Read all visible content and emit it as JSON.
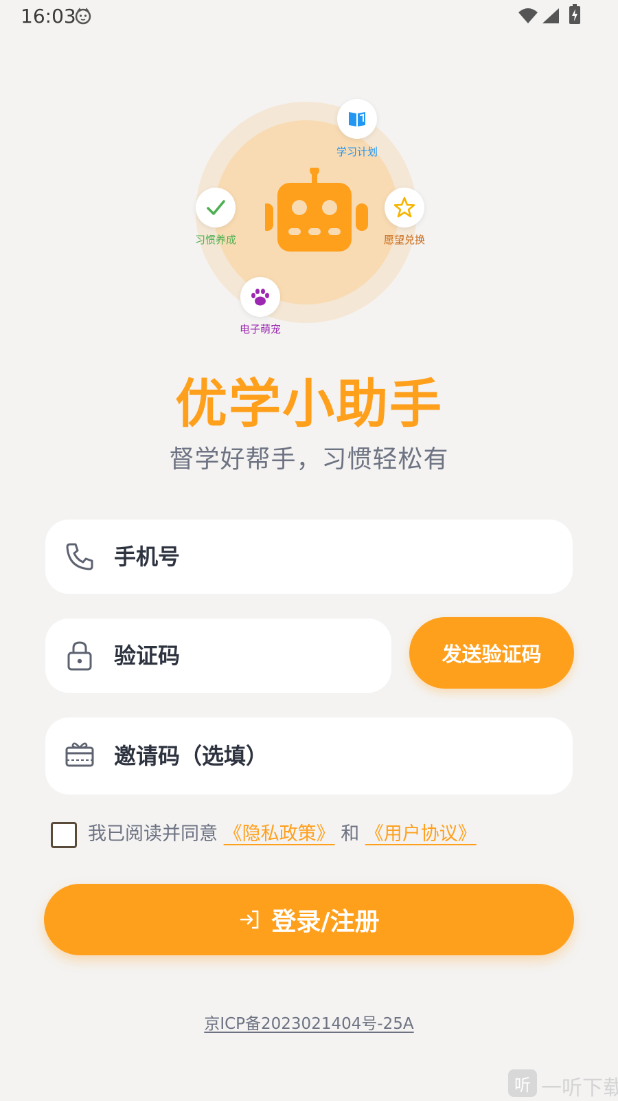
{
  "status_bar": {
    "time": "16:03"
  },
  "hero": {
    "features": [
      {
        "label": "学习计划",
        "icon": "book-icon",
        "color": "#2196f3"
      },
      {
        "label": "习惯养成",
        "icon": "checkmark-icon",
        "color": "#4caf50"
      },
      {
        "label": "愿望兑换",
        "icon": "star-icon",
        "color": "#c76a1a"
      },
      {
        "label": "电子萌宠",
        "icon": "paw-icon",
        "color": "#9c27b0"
      }
    ]
  },
  "app": {
    "title": "优学小助手",
    "subtitle": "督学好帮手，习惯轻松有"
  },
  "form": {
    "phone_placeholder": "手机号",
    "code_placeholder": "验证码",
    "send_code_label": "发送验证码",
    "invite_placeholder": "邀请码（选填）"
  },
  "agreement": {
    "prefix": "我已阅读并同意",
    "privacy_link": "《隐私政策》",
    "and": "和",
    "terms_link": "《用户协议》"
  },
  "login": {
    "label": "登录/注册"
  },
  "footer": {
    "icp": "京ICP备2023021404号-25A"
  },
  "watermark": {
    "logo_char": "听",
    "text": "一听下载"
  },
  "colors": {
    "accent": "#ffa01d",
    "background": "#f4f3f2",
    "text": "#2e3340",
    "muted": "#6d7382"
  }
}
